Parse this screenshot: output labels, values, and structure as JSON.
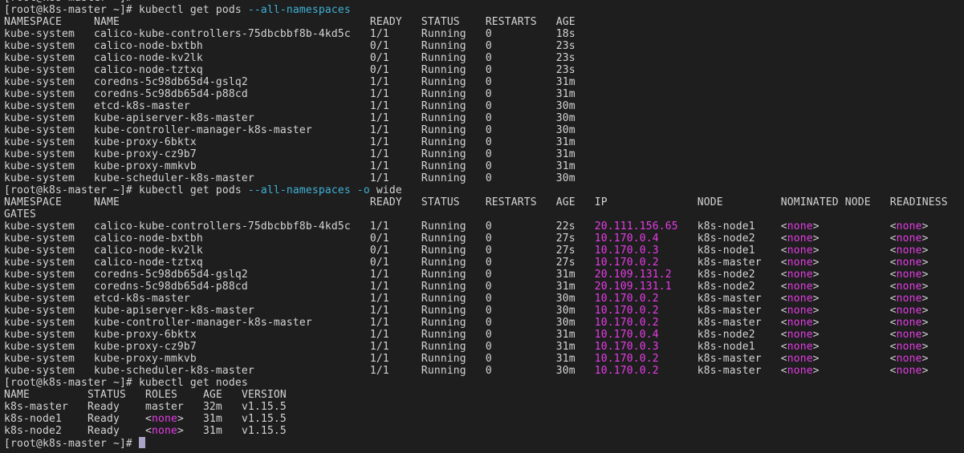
{
  "terminal": {
    "colors": {
      "background": "#1e1e1e",
      "text": "#d4d4d4",
      "flag": "#3fb2d6",
      "highlight": "#e83ce8",
      "cursor": "#a9a5c6"
    },
    "prompt": "[root@k8s-master ~]#",
    "blocks": [
      {
        "command": [
          {
            "text": "kubectl get pods",
            "flag": false
          },
          {
            "text": "--all-namespaces",
            "flag": true
          }
        ],
        "table": {
          "headers": [
            "NAMESPACE",
            "NAME",
            "READY",
            "STATUS",
            "RESTARTS",
            "AGE"
          ],
          "highlight_cols": [],
          "rows": [
            [
              "kube-system",
              "calico-kube-controllers-75dbcbbf8b-4kd5c",
              "1/1",
              "Running",
              "0",
              "18s"
            ],
            [
              "kube-system",
              "calico-node-bxtbh",
              "0/1",
              "Running",
              "0",
              "23s"
            ],
            [
              "kube-system",
              "calico-node-kv2lk",
              "0/1",
              "Running",
              "0",
              "23s"
            ],
            [
              "kube-system",
              "calico-node-tztxq",
              "0/1",
              "Running",
              "0",
              "23s"
            ],
            [
              "kube-system",
              "coredns-5c98db65d4-gslq2",
              "1/1",
              "Running",
              "0",
              "31m"
            ],
            [
              "kube-system",
              "coredns-5c98db65d4-p88cd",
              "1/1",
              "Running",
              "0",
              "31m"
            ],
            [
              "kube-system",
              "etcd-k8s-master",
              "1/1",
              "Running",
              "0",
              "30m"
            ],
            [
              "kube-system",
              "kube-apiserver-k8s-master",
              "1/1",
              "Running",
              "0",
              "30m"
            ],
            [
              "kube-system",
              "kube-controller-manager-k8s-master",
              "1/1",
              "Running",
              "0",
              "30m"
            ],
            [
              "kube-system",
              "kube-proxy-6bktx",
              "1/1",
              "Running",
              "0",
              "31m"
            ],
            [
              "kube-system",
              "kube-proxy-cz9b7",
              "1/1",
              "Running",
              "0",
              "31m"
            ],
            [
              "kube-system",
              "kube-proxy-mmkvb",
              "1/1",
              "Running",
              "0",
              "31m"
            ],
            [
              "kube-system",
              "kube-scheduler-k8s-master",
              "1/1",
              "Running",
              "0",
              "30m"
            ]
          ]
        }
      },
      {
        "command": [
          {
            "text": "kubectl get pods",
            "flag": false
          },
          {
            "text": "--all-namespaces",
            "flag": true
          },
          {
            "text": "-o",
            "flag": true
          },
          {
            "text": "wide",
            "flag": false
          }
        ],
        "table": {
          "headers": [
            "NAMESPACE",
            "NAME",
            "READY",
            "STATUS",
            "RESTARTS",
            "AGE",
            "IP",
            "NODE",
            "NOMINATED NODE",
            "READINESS GATES"
          ],
          "highlight_cols": [
            6
          ],
          "rows": [
            [
              "kube-system",
              "calico-kube-controllers-75dbcbbf8b-4kd5c",
              "1/1",
              "Running",
              "0",
              "22s",
              "20.111.156.65",
              "k8s-node1",
              "<none>",
              "<none>"
            ],
            [
              "kube-system",
              "calico-node-bxtbh",
              "0/1",
              "Running",
              "0",
              "27s",
              "10.170.0.4",
              "k8s-node2",
              "<none>",
              "<none>"
            ],
            [
              "kube-system",
              "calico-node-kv2lk",
              "0/1",
              "Running",
              "0",
              "27s",
              "10.170.0.3",
              "k8s-node1",
              "<none>",
              "<none>"
            ],
            [
              "kube-system",
              "calico-node-tztxq",
              "0/1",
              "Running",
              "0",
              "27s",
              "10.170.0.2",
              "k8s-master",
              "<none>",
              "<none>"
            ],
            [
              "kube-system",
              "coredns-5c98db65d4-gslq2",
              "1/1",
              "Running",
              "0",
              "31m",
              "20.109.131.2",
              "k8s-node2",
              "<none>",
              "<none>"
            ],
            [
              "kube-system",
              "coredns-5c98db65d4-p88cd",
              "1/1",
              "Running",
              "0",
              "31m",
              "20.109.131.1",
              "k8s-node2",
              "<none>",
              "<none>"
            ],
            [
              "kube-system",
              "etcd-k8s-master",
              "1/1",
              "Running",
              "0",
              "30m",
              "10.170.0.2",
              "k8s-master",
              "<none>",
              "<none>"
            ],
            [
              "kube-system",
              "kube-apiserver-k8s-master",
              "1/1",
              "Running",
              "0",
              "30m",
              "10.170.0.2",
              "k8s-master",
              "<none>",
              "<none>"
            ],
            [
              "kube-system",
              "kube-controller-manager-k8s-master",
              "1/1",
              "Running",
              "0",
              "30m",
              "10.170.0.2",
              "k8s-master",
              "<none>",
              "<none>"
            ],
            [
              "kube-system",
              "kube-proxy-6bktx",
              "1/1",
              "Running",
              "0",
              "31m",
              "10.170.0.4",
              "k8s-node2",
              "<none>",
              "<none>"
            ],
            [
              "kube-system",
              "kube-proxy-cz9b7",
              "1/1",
              "Running",
              "0",
              "31m",
              "10.170.0.3",
              "k8s-node1",
              "<none>",
              "<none>"
            ],
            [
              "kube-system",
              "kube-proxy-mmkvb",
              "1/1",
              "Running",
              "0",
              "31m",
              "10.170.0.2",
              "k8s-master",
              "<none>",
              "<none>"
            ],
            [
              "kube-system",
              "kube-scheduler-k8s-master",
              "1/1",
              "Running",
              "0",
              "30m",
              "10.170.0.2",
              "k8s-master",
              "<none>",
              "<none>"
            ]
          ]
        }
      },
      {
        "command": [
          {
            "text": "kubectl get nodes",
            "flag": false
          }
        ],
        "table": {
          "headers": [
            "NAME",
            "STATUS",
            "ROLES",
            "AGE",
            "VERSION"
          ],
          "highlight_cols": [],
          "rows": [
            [
              "k8s-master",
              "Ready",
              "master",
              "32m",
              "v1.15.5"
            ],
            [
              "k8s-node1",
              "Ready",
              "<none>",
              "31m",
              "v1.15.5"
            ],
            [
              "k8s-node2",
              "Ready",
              "<none>",
              "31m",
              "v1.15.5"
            ]
          ]
        }
      }
    ]
  }
}
